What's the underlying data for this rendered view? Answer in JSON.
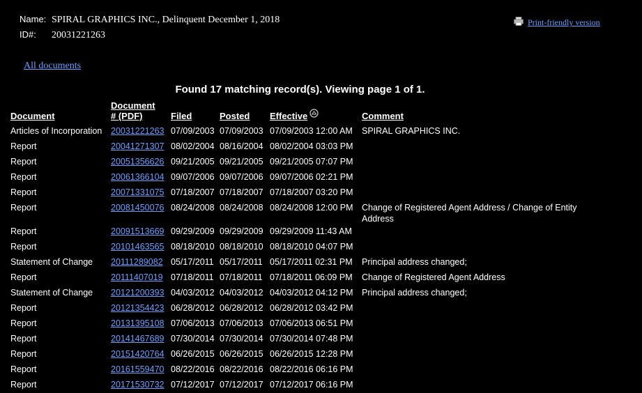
{
  "header": {
    "name_label": "Name:",
    "name_value": "SPIRAL GRAPHICS INC., Delinquent December 1, 2018",
    "id_label": "ID#:",
    "id_value": "20031221263"
  },
  "print_link": "Print-friendly version",
  "all_documents_link": "All documents",
  "found_text": "Found 17 matching record(s).  Viewing page 1 of 1.",
  "columns": {
    "document": "Document",
    "doc_num_line1": "Document",
    "doc_num_line2": "# (PDF)",
    "filed": "Filed",
    "posted": "Posted",
    "effective": "Effective",
    "comment": "Comment"
  },
  "rows": [
    {
      "document": "Articles of Incorporation",
      "num": "20031221263",
      "filed": "07/09/2003",
      "posted": "07/09/2003",
      "effective": "07/09/2003 12:00 AM",
      "comment": "SPIRAL GRAPHICS INC."
    },
    {
      "document": "Report",
      "num": "20041271307",
      "filed": "08/02/2004",
      "posted": "08/16/2004",
      "effective": "08/02/2004 03:03 PM",
      "comment": ""
    },
    {
      "document": "Report",
      "num": "20051356626",
      "filed": "09/21/2005",
      "posted": "09/21/2005",
      "effective": "09/21/2005 07:07 PM",
      "comment": ""
    },
    {
      "document": "Report",
      "num": "20061366104",
      "filed": "09/07/2006",
      "posted": "09/07/2006",
      "effective": "09/07/2006 02:21 PM",
      "comment": ""
    },
    {
      "document": "Report",
      "num": "20071331075",
      "filed": "07/18/2007",
      "posted": "07/18/2007",
      "effective": "07/18/2007 03:20 PM",
      "comment": ""
    },
    {
      "document": "Report",
      "num": "20081450076",
      "filed": "08/24/2008",
      "posted": "08/24/2008",
      "effective": "08/24/2008 12:00 PM",
      "comment": "Change of Registered Agent Address / Change of Entity Address"
    },
    {
      "document": "Report",
      "num": "20091513669",
      "filed": "09/29/2009",
      "posted": "09/29/2009",
      "effective": "09/29/2009 11:43 AM",
      "comment": ""
    },
    {
      "document": "Report",
      "num": "20101463565",
      "filed": "08/18/2010",
      "posted": "08/18/2010",
      "effective": "08/18/2010 04:07 PM",
      "comment": ""
    },
    {
      "document": "Statement of Change",
      "num": "20111289082",
      "filed": "05/17/2011",
      "posted": "05/17/2011",
      "effective": "05/17/2011 02:31 PM",
      "comment": "Principal address changed;"
    },
    {
      "document": "Report",
      "num": "20111407019",
      "filed": "07/18/2011",
      "posted": "07/18/2011",
      "effective": "07/18/2011 06:09 PM",
      "comment": "Change of Registered Agent Address"
    },
    {
      "document": "Statement of Change",
      "num": "20121200393",
      "filed": "04/03/2012",
      "posted": "04/03/2012",
      "effective": "04/03/2012 04:12 PM",
      "comment": "Principal address changed;"
    },
    {
      "document": "Report",
      "num": "20121354423",
      "filed": "06/28/2012",
      "posted": "06/28/2012",
      "effective": "06/28/2012 03:42 PM",
      "comment": ""
    },
    {
      "document": "Report",
      "num": "20131395108",
      "filed": "07/06/2013",
      "posted": "07/06/2013",
      "effective": "07/06/2013 06:51 PM",
      "comment": ""
    },
    {
      "document": "Report",
      "num": "20141467689",
      "filed": "07/30/2014",
      "posted": "07/30/2014",
      "effective": "07/30/2014 07:48 PM",
      "comment": ""
    },
    {
      "document": "Report",
      "num": "20151420764",
      "filed": "06/26/2015",
      "posted": "06/26/2015",
      "effective": "06/26/2015 12:28 PM",
      "comment": ""
    },
    {
      "document": "Report",
      "num": "20161559470",
      "filed": "08/22/2016",
      "posted": "08/22/2016",
      "effective": "08/22/2016 06:16 PM",
      "comment": ""
    },
    {
      "document": "Report",
      "num": "20171530732",
      "filed": "07/12/2017",
      "posted": "07/12/2017",
      "effective": "07/12/2017 06:16 PM",
      "comment": ""
    }
  ],
  "colors": {
    "background": "#000000",
    "text": "#ffffff",
    "link": "#6aa0ff"
  },
  "icons": {
    "print": "printer-icon",
    "sort": "sort-icon"
  }
}
